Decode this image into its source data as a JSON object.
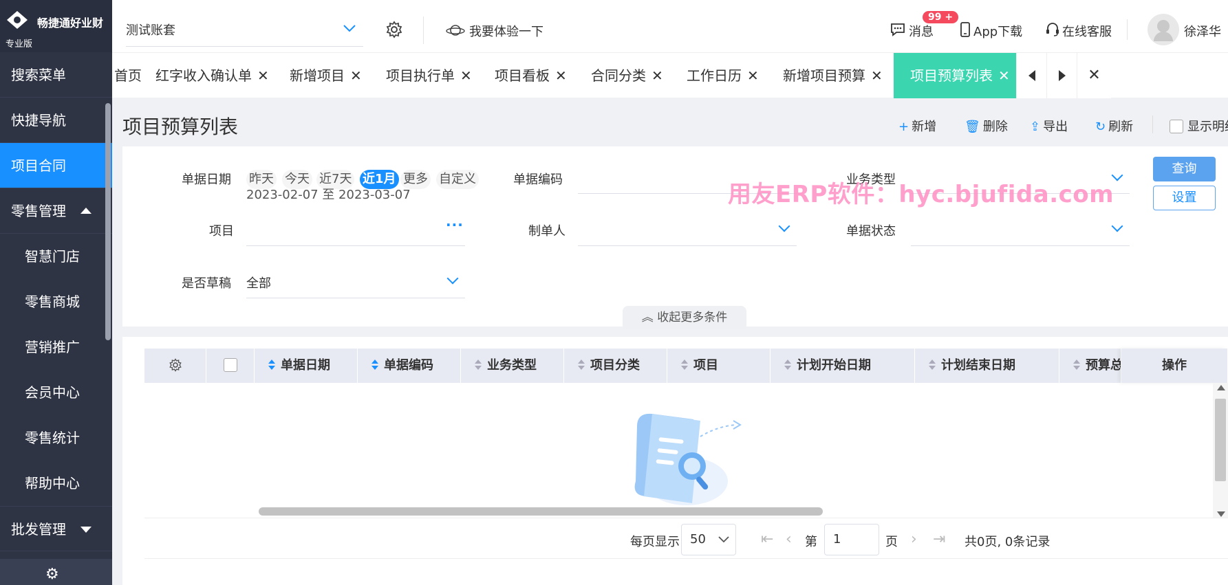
{
  "brand": {
    "name": "畅捷通好业财",
    "edition": "专业版"
  },
  "header": {
    "account_value": "测试账套",
    "experience_label": "我要体验一下",
    "messages_label": "消息",
    "messages_badge": "99 +",
    "app_download_label": "App下载",
    "service_label": "在线客服",
    "username": "徐泽华"
  },
  "sidebar": {
    "items": [
      {
        "label": "搜索菜单"
      },
      {
        "label": "快捷导航"
      },
      {
        "label": "项目合同"
      },
      {
        "label": "零售管理"
      }
    ],
    "retail_sub": [
      {
        "label": "智慧门店"
      },
      {
        "label": "零售商城"
      },
      {
        "label": "营销推广"
      },
      {
        "label": "会员中心"
      },
      {
        "label": "零售统计"
      },
      {
        "label": "帮助中心"
      }
    ],
    "wholesale": {
      "label": "批发管理"
    }
  },
  "tabs": [
    {
      "label": "首页"
    },
    {
      "label": "红字收入确认单"
    },
    {
      "label": "新增项目"
    },
    {
      "label": "项目执行单"
    },
    {
      "label": "项目看板"
    },
    {
      "label": "合同分类"
    },
    {
      "label": "工作日历"
    },
    {
      "label": "新增项目预算"
    },
    {
      "label": "项目预算列表"
    }
  ],
  "page": {
    "title": "项目预算列表",
    "toolbar": {
      "add": "新增",
      "delete": "删除",
      "export": "导出",
      "refresh": "刷新",
      "show_detail": "显示明细"
    }
  },
  "filter": {
    "doc_date_label": "单据日期",
    "date_options": [
      "昨天",
      "今天",
      "近7天",
      "近1月",
      "更多",
      "自定义"
    ],
    "selected_date_option": "近1月",
    "date_range": "2023-02-07 至 2023-03-07",
    "doc_code_label": "单据编码",
    "biz_type_label": "业务类型",
    "project_label": "项目",
    "creator_label": "制单人",
    "doc_status_label": "单据状态",
    "draft_label": "是否草稿",
    "draft_value": "全部",
    "query_button": "查询",
    "settings_button": "设置",
    "collapse_label": "收起更多条件"
  },
  "watermark": "用友ERP软件：hyc.bjufida.com",
  "table": {
    "columns": [
      "单据日期",
      "单据编码",
      "业务类型",
      "项目分类",
      "项目",
      "计划开始日期",
      "计划结束日期",
      "预算总"
    ],
    "action_column": "操作",
    "rows": []
  },
  "pager": {
    "per_page_label": "每页显示",
    "per_page_value": "50",
    "page_prefix": "第",
    "page_value": "1",
    "page_suffix": "页",
    "summary": "共0页, 0条记录"
  },
  "colors": {
    "accent": "#1890ff",
    "active_tab": "#3bd6b0",
    "sidebar_bg": "#2f3445",
    "badge": "#f5495d"
  }
}
